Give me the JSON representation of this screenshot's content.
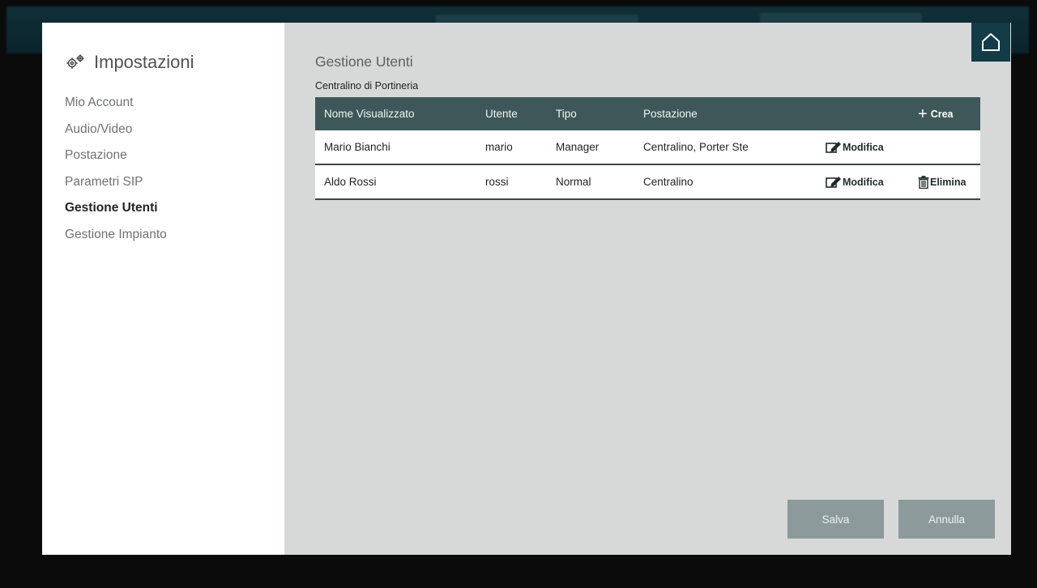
{
  "sidebar": {
    "title": "Impostazioni",
    "items": [
      {
        "label": "Mio Account"
      },
      {
        "label": "Audio/Video"
      },
      {
        "label": "Postazione"
      },
      {
        "label": "Parametri SIP"
      },
      {
        "label": "Gestione Utenti",
        "active": true
      },
      {
        "label": "Gestione Impianto"
      }
    ]
  },
  "main": {
    "title": "Gestione Utenti",
    "section": "Centralino di Portineria",
    "table": {
      "headers": [
        "Nome Visualizzato",
        "Utente",
        "Tipo",
        "Postazione"
      ],
      "create_label": "Crea",
      "rows": [
        {
          "name": "Mario Bianchi",
          "user": "mario",
          "type": "Manager",
          "station": "Centralino, Porter Ste",
          "edit": "Modifica"
        },
        {
          "name": "Aldo Rossi",
          "user": "rossi",
          "type": "Normal",
          "station": "Centralino",
          "edit": "Modifica",
          "delete": "Elimina"
        }
      ]
    }
  },
  "buttons": {
    "save": "Salva",
    "cancel": "Annulla"
  },
  "colors": {
    "header_bg": "#3e5859",
    "content_bg": "#d7d9d8",
    "button_bg": "#8c9a9c",
    "home_bg": "#123c46"
  },
  "icons": {
    "title": "gear-icon",
    "home": "home-icon",
    "create": "plus-icon",
    "edit": "edit-icon",
    "delete": "trash-icon"
  }
}
